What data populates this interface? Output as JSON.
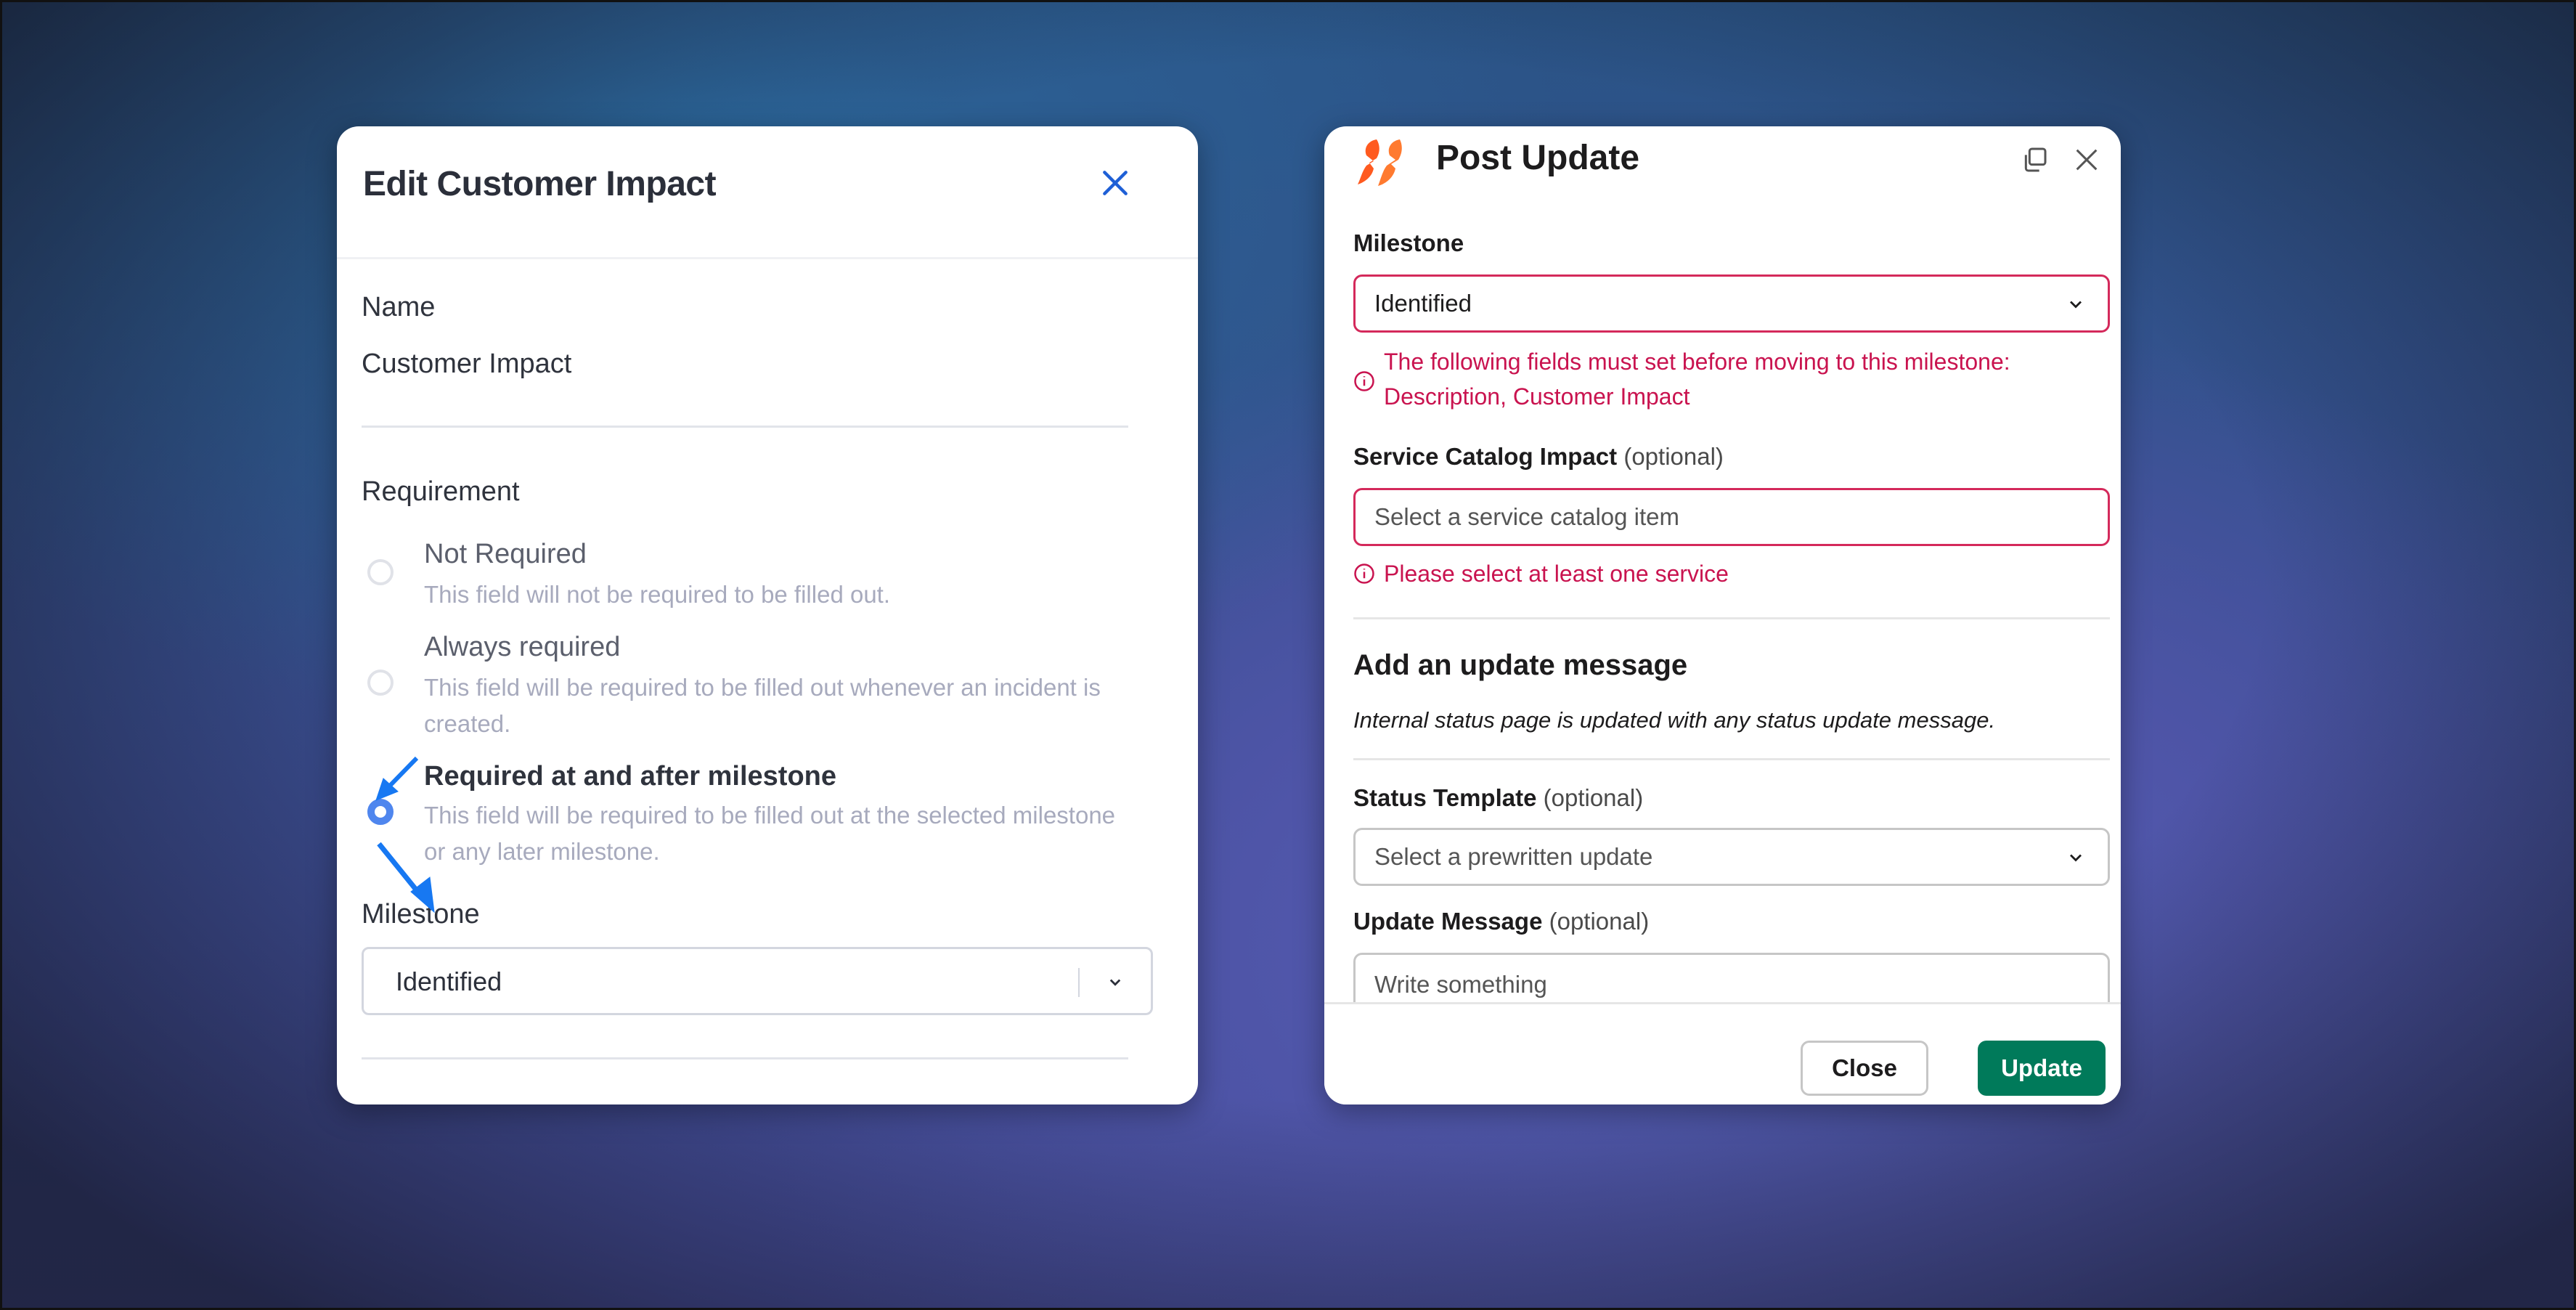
{
  "edit_dialog": {
    "title": "Edit Customer Impact",
    "close_icon": "close-icon",
    "name_label": "Name",
    "name_value": "Customer Impact",
    "requirement_label": "Requirement",
    "options": [
      {
        "title": "Not Required",
        "description": "This field will not be required to be filled out.",
        "selected": false
      },
      {
        "title": "Always required",
        "description": "This field will be required to be filled out whenever an incident is created.",
        "selected": false
      },
      {
        "title": "Required at and after milestone",
        "description": "This field will be required to be filled out at the selected milestone or any later milestone.",
        "selected": true
      }
    ],
    "milestone_label": "Milestone",
    "milestone_value": "Identified",
    "accent_color": "#1e5fd6"
  },
  "post_update": {
    "title": "Post Update",
    "logo_icon": "app-logo-icon",
    "milestone_label": "Milestone",
    "milestone_value": "Identified",
    "milestone_error": "The following fields must set before moving to this milestone:",
    "milestone_error_line2": "Description, Customer Impact",
    "service_label": "Service Catalog Impact",
    "service_optional": "(optional)",
    "service_placeholder": "Select a service catalog item",
    "service_error": "Please select at least one service",
    "section_heading": "Add an update message",
    "section_note": "Internal status page is updated with any status update message.",
    "template_label": "Status Template",
    "template_optional": "(optional)",
    "template_placeholder": "Select a prewritten update",
    "message_label": "Update Message",
    "message_optional": "(optional)",
    "message_placeholder": "Write something",
    "close_button": "Close",
    "update_button": "Update",
    "error_color": "#c9134f",
    "primary_color": "#007a5a"
  }
}
